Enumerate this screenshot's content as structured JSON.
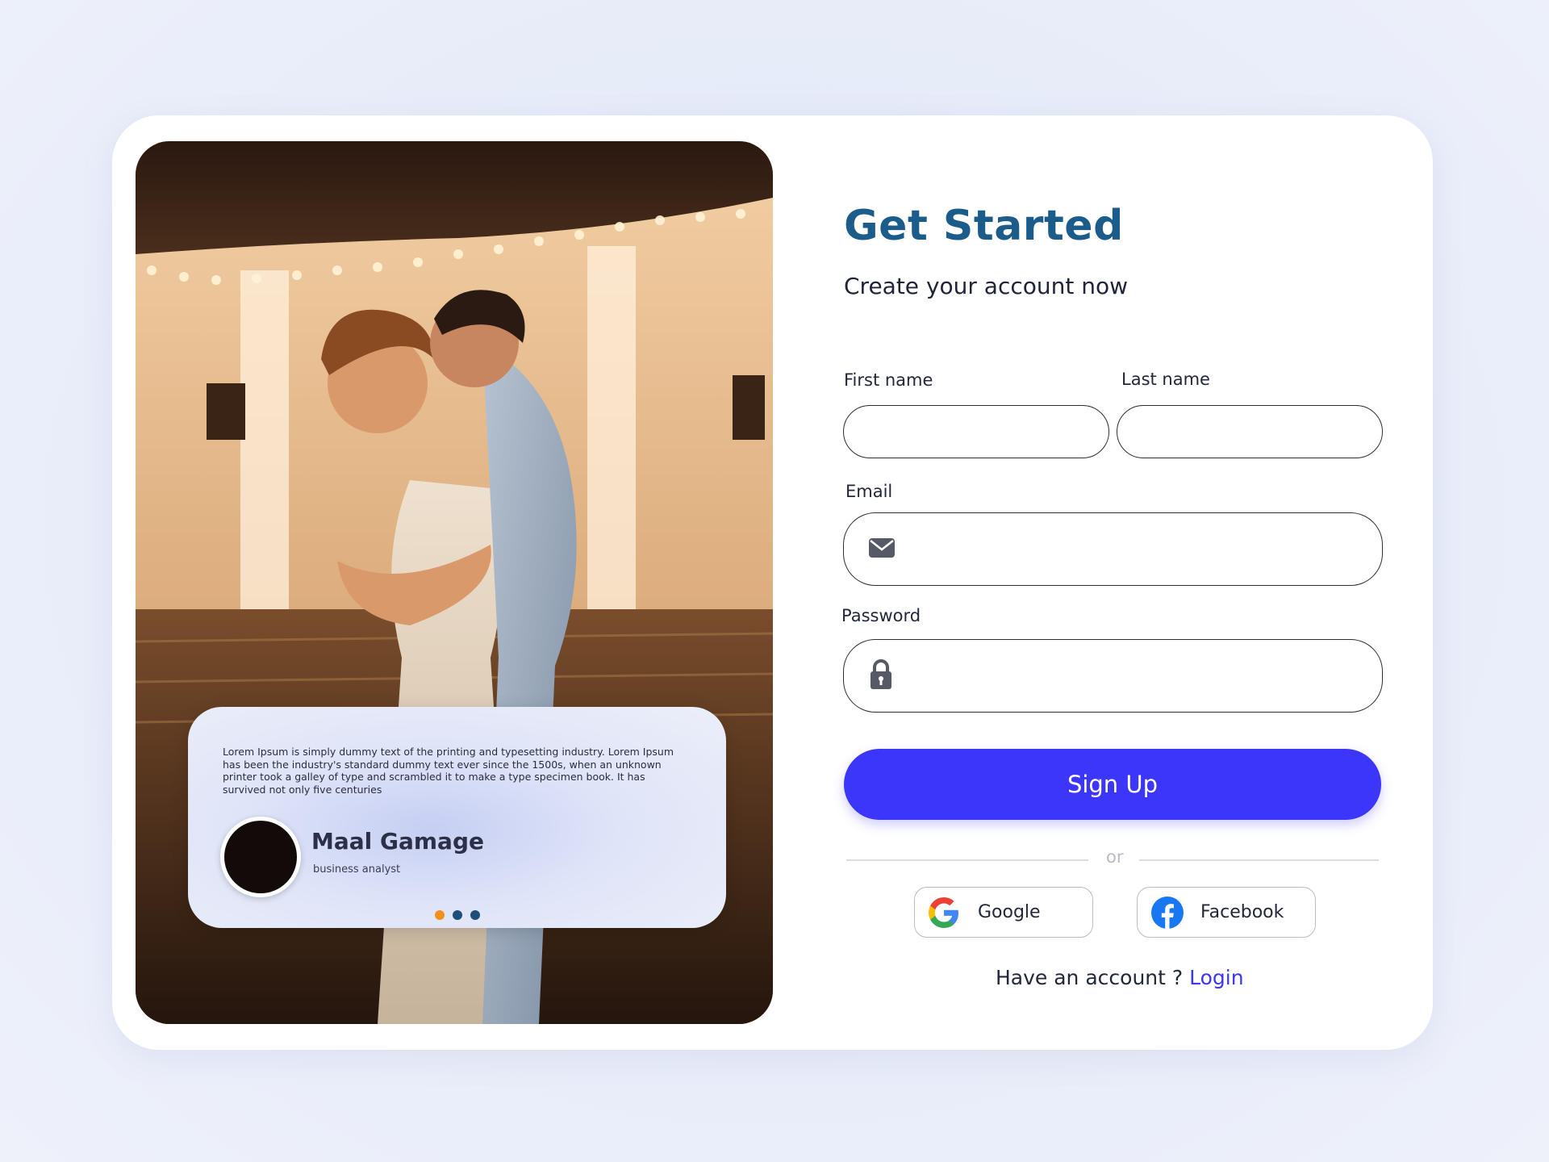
{
  "hero": {
    "testimonial_text": "Lorem Ipsum is simply dummy text of the printing and typesetting industry. Lorem Ipsum has been the industry's standard dummy text ever since the 1500s, when an unknown printer took a galley of type and scrambled it to make a type specimen book. It has survived not only five centuries",
    "author_name": "Maal Gamage",
    "author_role": "business analyst",
    "dot_colors": [
      "#f0901e",
      "#1e4f7a",
      "#1e4f7a"
    ]
  },
  "form": {
    "title": "Get Started",
    "subtitle": "Create your account now",
    "first_name_label": "First name",
    "last_name_label": "Last name",
    "email_label": "Email",
    "password_label": "Password",
    "first_name_value": "",
    "last_name_value": "",
    "email_value": "",
    "password_value": "",
    "signup_label": "Sign Up",
    "or_text": "or",
    "google_label": "Google",
    "facebook_label": "Facebook",
    "account_prompt": "Have an account ?",
    "login_label": "Login"
  },
  "icons": {
    "email": "envelope-icon",
    "password": "lock-icon",
    "google": "google-icon",
    "facebook": "facebook-icon"
  },
  "colors": {
    "title": "#1b5c8a",
    "accent": "#3c35fa",
    "login_link": "#3c35fa"
  }
}
